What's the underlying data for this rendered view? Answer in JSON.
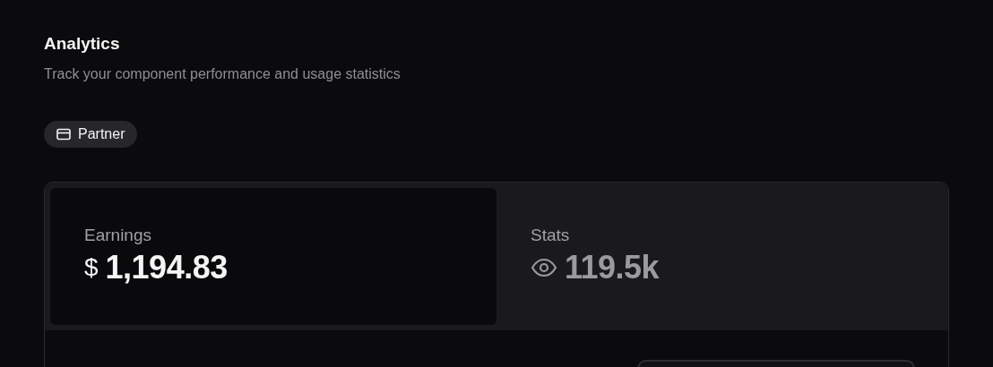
{
  "header": {
    "title": "Analytics",
    "subtitle": "Track your component performance and usage statistics"
  },
  "badge": {
    "label": "Partner"
  },
  "metrics": [
    {
      "kind": "currency",
      "label": "Earnings",
      "symbol": "$",
      "value": "1,194.83",
      "selected": true
    },
    {
      "kind": "views",
      "label": "Stats",
      "value": "119.5k",
      "selected": false
    }
  ]
}
